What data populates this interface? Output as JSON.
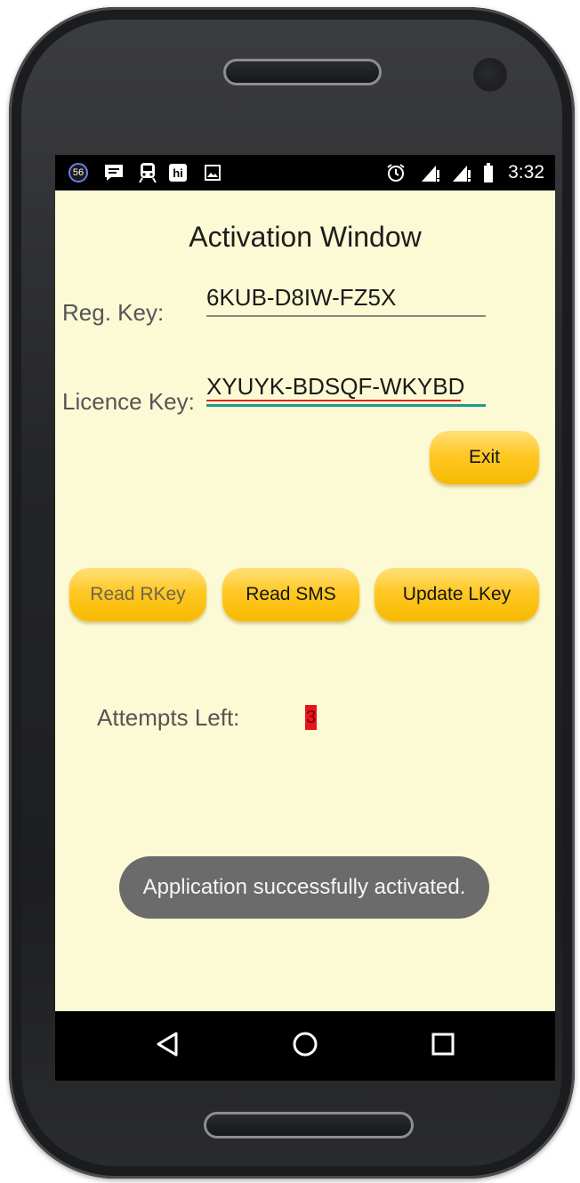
{
  "statusbar": {
    "notification_count": "56",
    "icons": [
      "notification-badge-icon",
      "message-icon",
      "train-icon",
      "hi-app-icon",
      "image-icon",
      "alarm-icon",
      "signal-icon",
      "signal-icon",
      "battery-icon"
    ],
    "hi_label": "hi",
    "time": "3:32"
  },
  "app": {
    "title": "Activation Window",
    "reg_key_label": "Reg. Key:",
    "reg_key_value": "6KUB-D8IW-FZ5X",
    "licence_key_label": "Licence Key:",
    "licence_key_value": "XYUYK-BDSQF-WKYBD",
    "exit_label": "Exit",
    "read_rkey_label": "Read RKey",
    "read_sms_label": "Read SMS",
    "update_lkey_label": "Update LKey",
    "attempts_label": "Attempts Left:",
    "attempts_value": "3"
  },
  "toast": {
    "message": "Application successfully activated."
  },
  "navbar": {
    "icons": [
      "back-icon",
      "home-icon",
      "recents-icon"
    ]
  },
  "colors": {
    "screen_background": "#fcfad4",
    "button_accent": "#ffc824",
    "focused_underline": "#1e9a8a",
    "spellcheck_underline": "#e02424",
    "attempts_highlight": "#e8141c"
  }
}
